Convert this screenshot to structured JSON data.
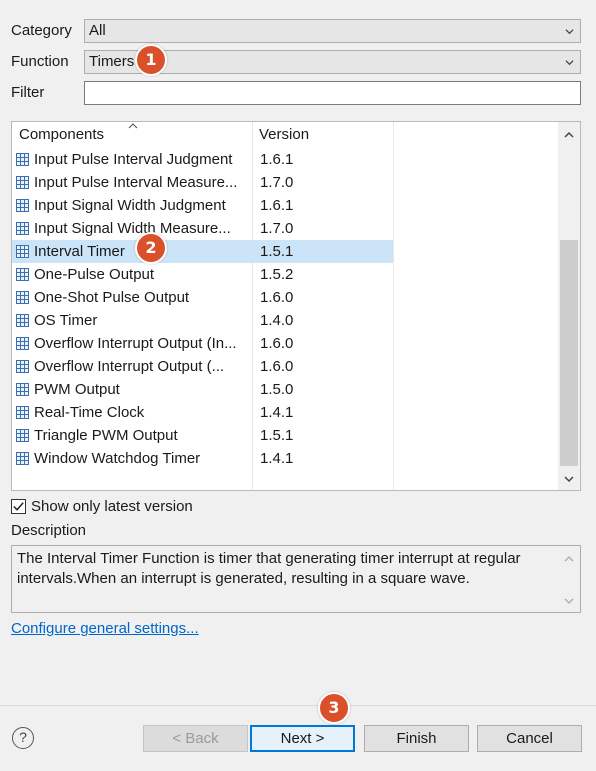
{
  "form": {
    "category_label": "Category",
    "category_value": "All",
    "function_label": "Function",
    "function_value": "Timers",
    "filter_label": "Filter",
    "filter_value": ""
  },
  "table": {
    "col_components": "Components",
    "col_version": "Version",
    "rows": [
      {
        "name": "Input Pulse Interval Judgment",
        "version": "1.6.1"
      },
      {
        "name": "Input Pulse Interval Measure...",
        "version": "1.7.0"
      },
      {
        "name": "Input Signal Width Judgment",
        "version": "1.6.1"
      },
      {
        "name": "Input Signal Width Measure...",
        "version": "1.7.0"
      },
      {
        "name": "Interval Timer",
        "version": "1.5.1"
      },
      {
        "name": "One-Pulse Output",
        "version": "1.5.2"
      },
      {
        "name": "One-Shot Pulse Output",
        "version": "1.6.0"
      },
      {
        "name": "OS Timer",
        "version": "1.4.0"
      },
      {
        "name": "Overflow Interrupt Output (In...",
        "version": "1.6.0"
      },
      {
        "name": "Overflow Interrupt Output (...",
        "version": "1.6.0"
      },
      {
        "name": "PWM Output",
        "version": "1.5.0"
      },
      {
        "name": "Real-Time Clock",
        "version": "1.4.1"
      },
      {
        "name": "Triangle PWM Output",
        "version": "1.5.1"
      },
      {
        "name": "Window Watchdog Timer",
        "version": "1.4.1"
      }
    ],
    "selected_index": 4
  },
  "options": {
    "latest_only_label": "Show only latest version",
    "latest_only_checked": true
  },
  "description": {
    "label": "Description",
    "text": "The Interval Timer Function is timer that generating timer interrupt at regular intervals.When an interrupt is generated, resulting in a square wave."
  },
  "configure_link": "Configure general settings...",
  "buttons": {
    "help": "?",
    "back": "< Back",
    "next": "Next >",
    "finish": "Finish",
    "cancel": "Cancel"
  },
  "badges": {
    "one": "1",
    "two": "2",
    "three": "3"
  },
  "colors": {
    "selection": "#cce4f7",
    "badge": "#d9502b",
    "link": "#0066cc",
    "default_button_border": "#0078d7",
    "component_icon": "#3a6fb0"
  },
  "icons": {
    "row_icon": "component-grid-icon",
    "dropdown": "chevron-down-icon",
    "sort": "sort-ascending-icon"
  }
}
